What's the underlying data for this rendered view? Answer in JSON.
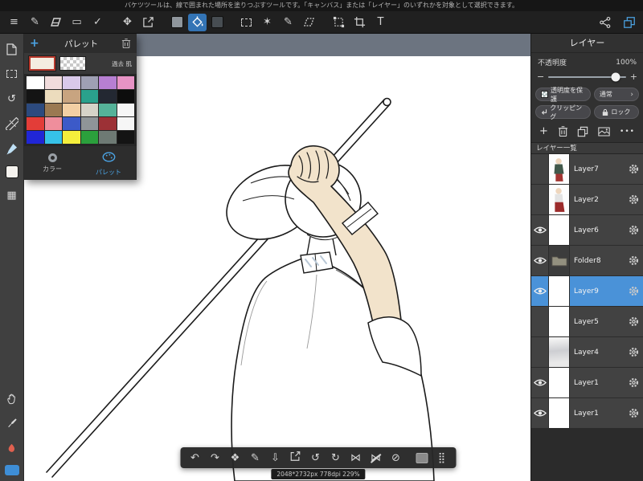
{
  "tooltip_bar": {
    "text": "バケツツールは、線で囲まれた場所を塗りつぶすツールです。「キャンバス」または「レイヤー」のいずれかを対象として選択できます。"
  },
  "icons": {
    "menu": "≡",
    "pen": "✎",
    "shape": "▭",
    "polyline": "✓",
    "move": "✥",
    "wand": "✶",
    "text": "T",
    "rotate_reset": "↺",
    "materials": "▦",
    "undo": "↶",
    "redo": "↷",
    "transform_free": "❖",
    "save": "⇩",
    "rotate_ccw": "↺",
    "rotate_cw": "↻",
    "flip_h": "⋈",
    "flip_v": "⋈",
    "reset_view": "⊘",
    "drag_handle": "⣿",
    "plus": "+",
    "minus": "−",
    "more": "•••",
    "chevron_right": "›"
  },
  "palette_panel": {
    "title": "パレット",
    "history_label": "過去 肌",
    "current_color": "#f4ede1",
    "tabs": [
      {
        "label": "カラー"
      },
      {
        "label": "パレット"
      }
    ],
    "swatches": [
      "#ffffff",
      "#f1dcdc",
      "#d9c9ea",
      "#9fa0b4",
      "#b77fd2",
      "#e793c5",
      "#141414",
      "#ecdcbd",
      "#c8a480",
      "#2aa18c",
      "#232832",
      "#0d0d0d",
      "#2c4a7e",
      "#9a7952",
      "#f2cfa4",
      "#d6d3c8",
      "#55b299",
      "#f6f6f6",
      "#e33d38",
      "#ef8e9c",
      "#3c5ac8",
      "#8f9598",
      "#9c3136",
      "#f6f6f6",
      "#2026d6",
      "#36c2e8",
      "#f4ee3c",
      "#2ba03c",
      "#6e7a74",
      "#141414"
    ]
  },
  "canvas": {
    "zoom_info": "2048*2732px 778dpi 229%"
  },
  "layers_panel": {
    "title": "レイヤー",
    "opacity_label": "不透明度",
    "opacity_value": "100%",
    "protect_alpha_label": "透明度を保護",
    "blend_mode_label": "通常",
    "clipping_label": "クリッピング",
    "lock_label": "ロック",
    "list_header": "レイヤー一覧",
    "layers": [
      {
        "name": "Layer7",
        "visible": false,
        "thumb": "art1",
        "selected": false
      },
      {
        "name": "Layer2",
        "visible": false,
        "thumb": "art2",
        "selected": false
      },
      {
        "name": "Layer6",
        "visible": true,
        "thumb": "checker",
        "selected": false
      },
      {
        "name": "Folder8",
        "visible": true,
        "thumb": "folder",
        "selected": false
      },
      {
        "name": "Layer9",
        "visible": true,
        "thumb": "checker",
        "selected": true
      },
      {
        "name": "Layer5",
        "visible": false,
        "thumb": "checker",
        "selected": false
      },
      {
        "name": "Layer4",
        "visible": false,
        "thumb": "gray",
        "selected": false
      },
      {
        "name": "Layer1",
        "visible": true,
        "thumb": "checker",
        "selected": false
      },
      {
        "name": "Layer1",
        "visible": true,
        "thumb": "checker",
        "selected": false
      }
    ]
  },
  "colors": {
    "accent_blue": "#4ba3e3",
    "selected_layer": "#4a92d8",
    "canvas_bg": "#6c7480",
    "skin_tone": "#f2e3cb"
  }
}
